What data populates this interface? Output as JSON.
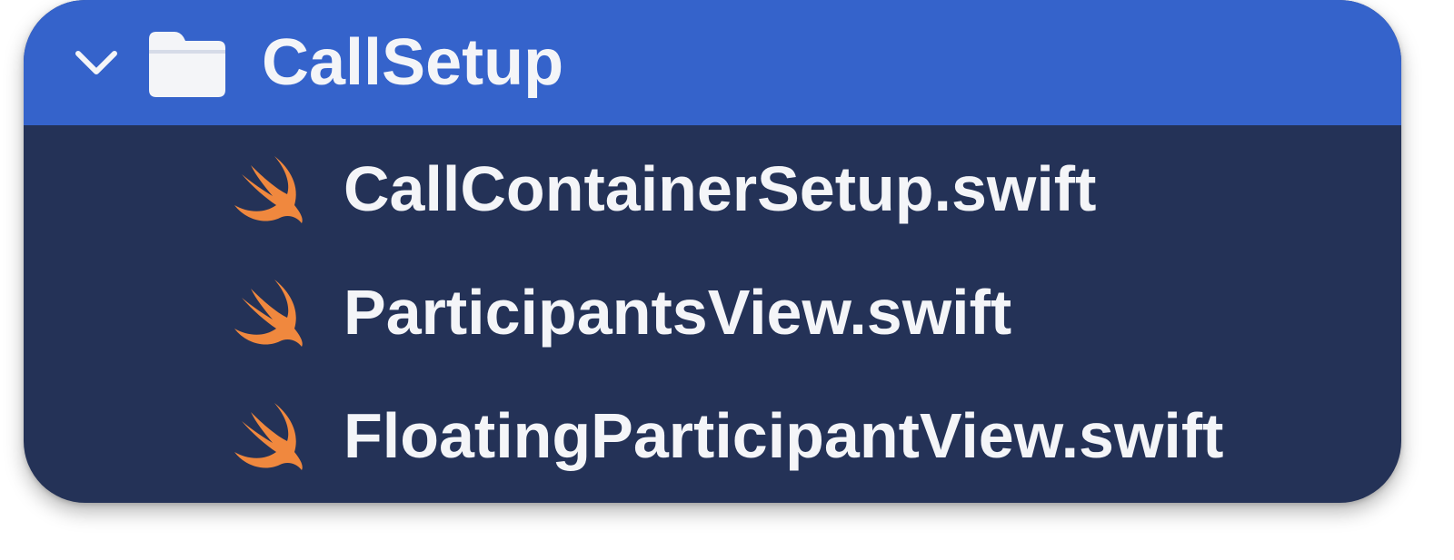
{
  "folder": {
    "name": "CallSetup",
    "expanded": true,
    "chevron_icon": "chevron-down-icon",
    "folder_icon": "folder-icon"
  },
  "files": [
    {
      "name": "CallContainerSetup.swift",
      "icon": "swift-icon"
    },
    {
      "name": "ParticipantsView.swift",
      "icon": "swift-icon"
    },
    {
      "name": "FloatingParticipantView.swift",
      "icon": "swift-icon"
    }
  ],
  "colors": {
    "selection": "#3563cb",
    "background": "#243257",
    "text": "#f4f5f8",
    "swift_orange": "#f0883e"
  }
}
